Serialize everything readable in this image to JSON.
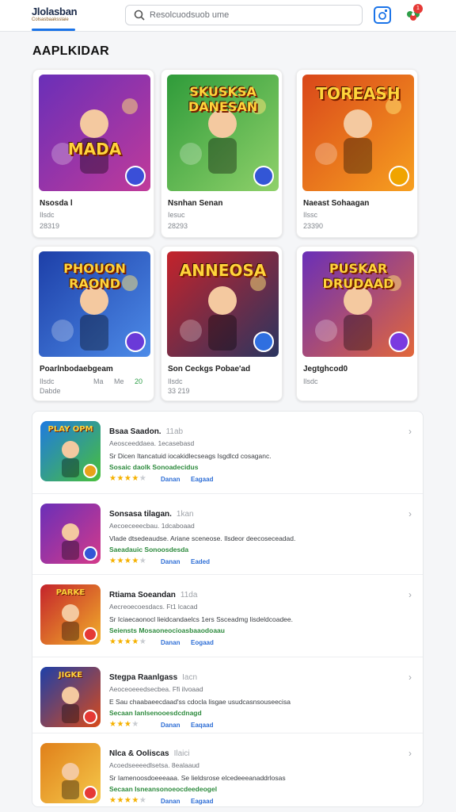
{
  "header": {
    "logo_title": "Jlolasban",
    "logo_sub": "Colsasbaaksslaie",
    "search_placeholder": "Resolcuodsuob ume",
    "notification_count": "1"
  },
  "section_title": "AAPLKIDAR",
  "grid": [
    {
      "art": "MADA",
      "title": "Nsosda l",
      "meta1": "Ilsdc",
      "meta2": "28319",
      "colors": [
        "#6a2fb8",
        "#c03a9a"
      ],
      "icon_color": "#3a4fd8"
    },
    {
      "art": "SKUSKSA DANESAN",
      "title": "Nsnhan Senan",
      "meta1": "Iesuc",
      "meta2": "28293",
      "colors": [
        "#2f9b3a",
        "#8fd16a"
      ],
      "icon_color": "#3356d6"
    },
    {
      "art": "TOREASH",
      "title": "Naeast Sohaagan",
      "meta1": "Ilssc",
      "meta2": "23390",
      "colors": [
        "#d9471a",
        "#f7a020"
      ],
      "icon_color": "#f0a400"
    },
    {
      "art": "PHOUON RAOND",
      "title": "Poarlnbodaebgeam",
      "meta1": "Ilsdc",
      "meta2": "Dabde",
      "colors": [
        "#1d3fa8",
        "#4d8be8"
      ],
      "icon_color": "#6a3ad8",
      "extra": [
        "Ma",
        "Me",
        "20"
      ]
    },
    {
      "art": "ANNEOSA",
      "title": "Son Ceckgs Pobae'ad",
      "meta1": "Ilsdc",
      "meta2": "33 219",
      "colors": [
        "#c4232b",
        "#2a3560"
      ],
      "icon_color": "#2f6fe0"
    },
    {
      "art": "PUSKAR DRUDAAD",
      "title": "Jegtghcod0",
      "meta1": "Ilsdc",
      "meta2": "",
      "colors": [
        "#6a2fb8",
        "#e2673a"
      ],
      "icon_color": "#7a3ae0"
    }
  ],
  "list": [
    {
      "art": "PLAY OPM",
      "title": "Bsaa Saadon.",
      "size": "11ab",
      "sub": "Aeosceeddaea. 1ecasebasd",
      "desc": "Sr Dicen Itancatuid iocakidlecseags Isgdlcd cosaganc.",
      "green": "Sosaic daolk Sonoadecidus",
      "stars": "★★★★",
      "dim": "★",
      "link1": "Danan",
      "link2": "Eagaad",
      "colors": [
        "#1f7ae0",
        "#49c03a"
      ],
      "badge": "#e8a21a"
    },
    {
      "art": "",
      "title": "Sonsasa tilagan.",
      "size": "1kan",
      "sub": "Aecoeceeecbau. 1dcaboaad",
      "desc": "Vlade dtsedeaudse. Ariane sceneose. Ilsdeor deecoseceadad.",
      "green": "Saeadauic Sonoosdesda",
      "stars": "★★★★",
      "dim": "★",
      "link1": "Danan",
      "link2": "Eaded",
      "colors": [
        "#6a2fb8",
        "#d43a8a"
      ],
      "badge": "#3356d6"
    },
    {
      "art": "PARKE",
      "title": "Rtiama Soeandan",
      "size": "11da",
      "sub": "Aecreoecoesdacs. Ft1 lcacad",
      "desc": "Sr Iciaecaonocl lieidcandaelcs 1ers Ssceadmg lisdeldcoadee.",
      "green": "Seiensts Mosaoneocioasbaaodoaau",
      "stars": "★★★★",
      "dim": "★",
      "link1": "Danan",
      "link2": "Eogaad",
      "colors": [
        "#c4232b",
        "#f2b02a"
      ],
      "badge": "#e53935"
    },
    {
      "art": "JIGKE",
      "title": "Stegpa Raanlgass",
      "size": "Iacn",
      "sub": "Aeoceoeeedsecbea. Ffi ilvoaad",
      "desc": "E Sau chaabaeecdaad'ss cdocla lisgae usudcasnsouseecisa",
      "green": "Secaan Ianlsenooesdcdnagd",
      "stars": "★★★",
      "dim": "★",
      "link1": "Danan",
      "link2": "Eaqaad",
      "colors": [
        "#1d3fa8",
        "#d94a1a"
      ],
      "badge": "#e53935"
    },
    {
      "art": "",
      "title": "Nlca & Ooliscas",
      "size": "Ilaici",
      "sub": "Acoedseeeedlsetsa. 8ealaaud",
      "desc": "Sr Iamenoosdoeeeaaa. Se lieldsrose elcedeeeanaddrlosas",
      "green": "Secaan Isneansonoeocdeedeogel",
      "stars": "★★★★",
      "dim": "★",
      "link1": "Danan",
      "link2": "Eagaad",
      "colors": [
        "#e0801a",
        "#f5c84a"
      ],
      "badge": "#e53935"
    }
  ],
  "accent": "#1a73e8"
}
